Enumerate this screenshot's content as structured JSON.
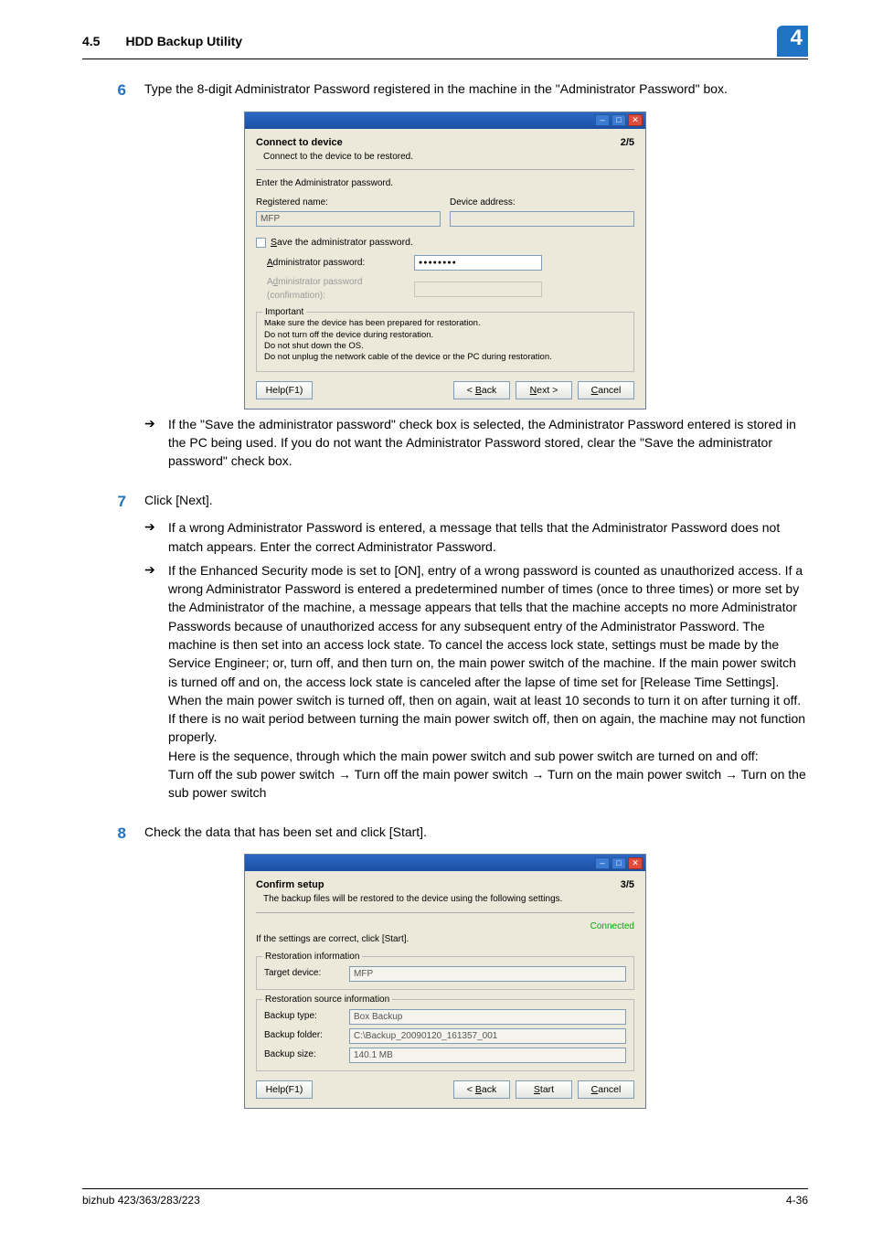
{
  "header": {
    "section_no": "4.5",
    "section_title": "HDD Backup Utility",
    "chapter_badge": "4"
  },
  "step6": {
    "num": "6",
    "text": "Type the 8-digit Administrator Password registered in the machine in the \"Administrator Password\" box."
  },
  "dialog1": {
    "title": "Connect to device",
    "subtitle": "Connect to the device to be restored.",
    "step": "2/5",
    "prompt": "Enter the Administrator password.",
    "reg_name_label": "Registered name:",
    "reg_name_val": "MFP",
    "dev_addr_label": "Device address:",
    "dev_addr_val": "",
    "save_chk": "Save the administrator password.",
    "admin_pwd_label": "Administrator password:",
    "admin_pwd_val": "●●●●●●●●",
    "admin_pwd_conf_label": "Administrator password (confirmation):",
    "important_legend": "Important",
    "important_lines": [
      "Make sure the device has been prepared for restoration.",
      "Do not turn off the device during restoration.",
      "Do not shut down the OS.",
      "Do not unplug the network cable of the device or the PC during restoration."
    ],
    "help": "Help(F1)",
    "back": "< Back",
    "next": "Next >",
    "cancel": "Cancel"
  },
  "step6_bullet": "If the \"Save the administrator password\" check box is selected, the Administrator Password entered is stored in the PC being used. If you do not want the Administrator Password stored, clear the \"Save the administrator password\" check box.",
  "step7": {
    "num": "7",
    "text": "Click [Next].",
    "b1": "If a wrong Administrator Password is entered, a message that tells that the Administrator Password does not match appears. Enter the correct Administrator Password.",
    "b2": "If the Enhanced Security mode is set to [ON], entry of a wrong password is counted as unauthorized access. If a wrong Administrator Password is entered a predetermined number of times (once to three times) or more set by the Administrator of the machine, a message appears that tells that the machine accepts no more Administrator Passwords because of unauthorized access for any subsequent entry of the Administrator Password. The machine is then set into an access lock state. To cancel the access lock state, settings must be made by the Service Engineer; or, turn off, and then turn on, the main power switch of the machine. If the main power switch is turned off and on, the access lock state is canceled after the lapse of time set for [Release Time Settings]. When the main power switch is turned off, then on again, wait at least 10 seconds to turn it on after turning it off. If there is no wait period between turning the main power switch off, then on again, the machine may not function properly.",
    "seq_intro": "Here is the sequence, through which the main power switch and sub power switch are turned on and off:",
    "seq": "Turn off the sub power switch → Turn off the main power switch → Turn on the main power switch → Turn on the sub power switch"
  },
  "step8": {
    "num": "8",
    "text": "Check the data that has been set and click [Start]."
  },
  "dialog2": {
    "title": "Confirm setup",
    "subtitle": "The backup files will be restored to the device using the following settings.",
    "step": "3/5",
    "connected": "Connected",
    "hint": "If the settings are correct, click [Start].",
    "rest_info_legend": "Restoration information",
    "target_dev_label": "Target device:",
    "target_dev_val": "MFP",
    "src_info_legend": "Restoration source information",
    "backup_type_label": "Backup type:",
    "backup_type_val": "Box Backup",
    "backup_folder_label": "Backup folder:",
    "backup_folder_val": "C:\\Backup_20090120_161357_001",
    "backup_size_label": "Backup size:",
    "backup_size_val": "140.1 MB",
    "help": "Help(F1)",
    "back": "< Back",
    "start": "Start",
    "cancel": "Cancel"
  },
  "footer": {
    "model": "bizhub 423/363/283/223",
    "page": "4-36"
  }
}
